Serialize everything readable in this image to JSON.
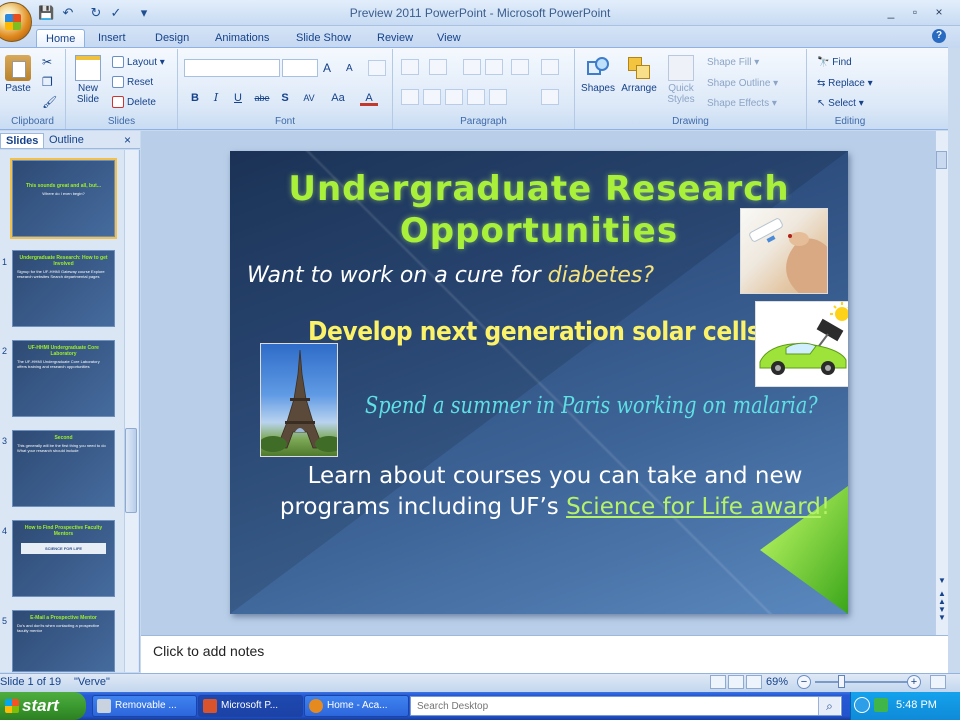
{
  "window": {
    "title": "Preview 2011 PowerPoint - Microsoft PowerPoint",
    "min": "_",
    "restore": "▫",
    "close": "×"
  },
  "qat": {
    "more": "▾"
  },
  "tabs": [
    "Home",
    "Insert",
    "Design",
    "Animations",
    "Slide Show",
    "Review",
    "View"
  ],
  "help": "?",
  "ribbon": {
    "clipboard": {
      "label": "Clipboard",
      "paste": "Paste"
    },
    "slides": {
      "label": "Slides",
      "new_slide": "New Slide",
      "layout": "Layout",
      "reset": "Reset",
      "delete": "Delete"
    },
    "font": {
      "label": "Font",
      "bold": "B",
      "italic": "I",
      "underline": "U",
      "strike": "abe",
      "shadow": "S",
      "spacing": "AV",
      "case": "Aa",
      "color": "A",
      "grow": "A",
      "shrink": "A"
    },
    "paragraph": {
      "label": "Paragraph"
    },
    "drawing": {
      "label": "Drawing",
      "shapes": "Shapes",
      "arrange": "Arrange",
      "quick_styles": "Quick Styles",
      "shape_fill": "Shape Fill",
      "shape_outline": "Shape Outline",
      "shape_effects": "Shape Effects"
    },
    "editing": {
      "label": "Editing",
      "find": "Find",
      "replace": "Replace",
      "select": "Select"
    }
  },
  "pane": {
    "tab_slides": "Slides",
    "tab_outline": "Outline",
    "close": "×",
    "thumbs": [
      {
        "num": "",
        "title": "This sounds great and all, but...",
        "body": "Where do I even begin?"
      },
      {
        "num": "1",
        "title": "Undergraduate Research: How to get Involved",
        "body": "Signup for the UF-HHMI Gateway course\n\nExplore research websites\n\nSearch departmental pages"
      },
      {
        "num": "2",
        "title": "UF-HHMI Undergraduate Core Laboratory",
        "body": "The UF-HHMI Undergraduate Core Laboratory offers training and research opportunities"
      },
      {
        "num": "3",
        "title": "Second",
        "body": "This generally will be the first thing you need to do\n\nWhat your research should include"
      },
      {
        "num": "4",
        "title": "How to Find Prospective Faculty Mentors",
        "body": "SCIENCE FOR LIFE"
      },
      {
        "num": "5",
        "title": "E-Mail a Prospective Mentor",
        "body": "Do's and don'ts when contacting a prospective faculty mentor"
      }
    ]
  },
  "slide": {
    "title": "Undergraduate Research Opportunities",
    "line1_pre": "Want to work on a cure for ",
    "line1_hl": "diabetes?",
    "line2": "Develop next generation solar cells?",
    "line3": "Spend a summer in Paris working on malaria?",
    "line4_pre": "Learn about courses you can take and new programs including UF’s ",
    "line4_link": "Science for Life award",
    "line4_post": "!"
  },
  "notes": {
    "placeholder": "Click to add notes"
  },
  "status": {
    "slide": "Slide 1 of 19",
    "theme": "\"Verve\"",
    "zoom": "69%",
    "zoom_minus": "−",
    "zoom_plus": "+"
  },
  "taskbar": {
    "start": "start",
    "tasks": [
      "Removable ...",
      "Microsoft P...",
      "Home - Aca..."
    ],
    "search_placeholder": "Search Desktop",
    "clock": "5:48 PM"
  },
  "colors": {
    "accent": "#a8f03a",
    "yellow": "#fbf26a",
    "cyan": "#5ee0e4",
    "ribbon": "#dde9f8"
  }
}
